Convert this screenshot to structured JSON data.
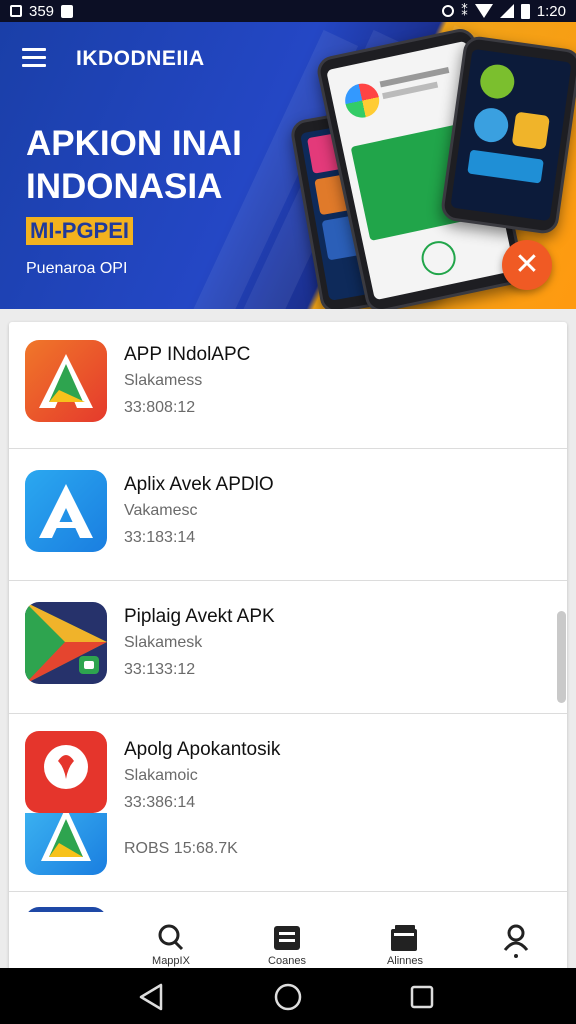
{
  "status_bar": {
    "left_text": "359",
    "time": "1:20"
  },
  "header": {
    "brand": "IKDODNEIIA",
    "headline_1": "APKION INAI",
    "headline_2": "INDONASIA",
    "promo": "MI-PGPEI",
    "subline": "Puenaroa OPI"
  },
  "apps": [
    {
      "title": "APP INdolAPC",
      "subtitle": "Slakamess",
      "meta": "33:808:12"
    },
    {
      "title": "Aplix Avek APDlO",
      "subtitle": "Vakamesc",
      "meta": "33:183:14"
    },
    {
      "title": "Piplaig Avekt APK",
      "subtitle": "Slakamesk",
      "meta": "33:133:12"
    },
    {
      "title": "Apolg Apokantosik",
      "subtitle": "Slakamoic",
      "meta": "33:386:14",
      "extra": "ROBS 15:68.7K"
    }
  ],
  "bottom_nav": {
    "items": [
      {
        "label": "MappIX",
        "icon": "search-icon"
      },
      {
        "label": "Coanes",
        "icon": "list-icon"
      },
      {
        "label": "Alinnes",
        "icon": "folder-icon"
      },
      {
        "label": "",
        "icon": "profile-icon"
      }
    ]
  },
  "colors": {
    "banner_blue": "#2447c5",
    "banner_orange": "#ff9a10",
    "promo_yellow": "#f3b21e",
    "fab_orange": "#f05a24"
  }
}
